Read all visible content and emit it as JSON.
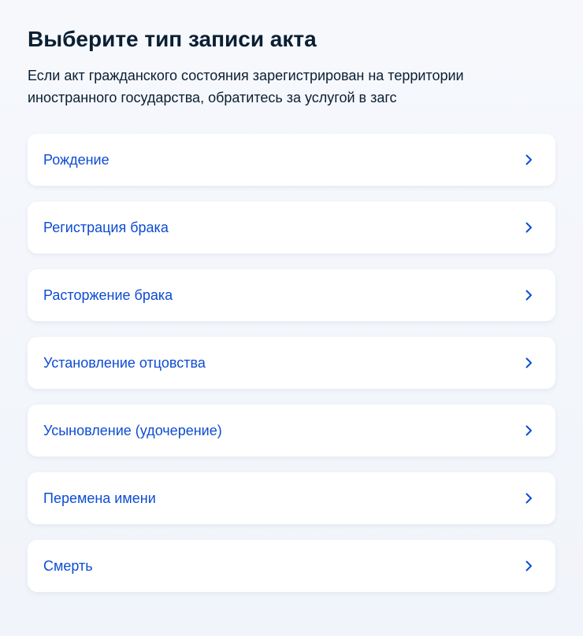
{
  "page": {
    "title": "Выберите тип записи акта",
    "description": "Если акт гражданского состояния зарегистрирован на территории иностранного государства, обратитесь за услугой в загс"
  },
  "options": [
    {
      "label": "Рождение",
      "icon": "chevron-right-icon"
    },
    {
      "label": "Регистрация брака",
      "icon": "chevron-right-icon"
    },
    {
      "label": "Расторжение брака",
      "icon": "chevron-right-icon"
    },
    {
      "label": "Установление отцовства",
      "icon": "chevron-right-icon"
    },
    {
      "label": "Усыновление (удочерение)",
      "icon": "chevron-right-icon"
    },
    {
      "label": "Перемена имени",
      "icon": "chevron-right-icon"
    },
    {
      "label": "Смерть",
      "icon": "chevron-right-icon"
    }
  ],
  "colors": {
    "link": "#0d4cd3",
    "text": "#0b1f33",
    "background": "#f3f6fb",
    "card": "#ffffff"
  }
}
